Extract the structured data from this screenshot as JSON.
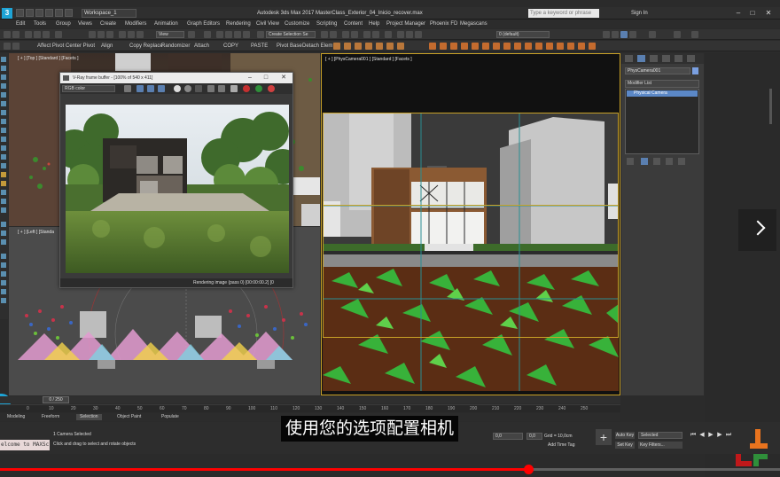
{
  "titlebar": {
    "logo": "3",
    "workspace": "Workspace_1",
    "title": "Autodesk 3ds Max 2017    MasterClass_Exterior_04_Inicio_recover.max",
    "search_placeholder": "Type a keyword or phrase",
    "signin": "Sign In",
    "minimize": "–",
    "maximize": "□",
    "close": "✕"
  },
  "menu": [
    "Edit",
    "Tools",
    "Group",
    "Views",
    "Create",
    "Modifiers",
    "Animation",
    "Graph Editors",
    "Rendering",
    "Civil View",
    "Customize",
    "Scripting",
    "Content",
    "Help",
    "Project Manager",
    "Phoenix FD",
    "Megascans"
  ],
  "toolbar1": {
    "view_dropdown": "View",
    "create_selection": "Create Selection Se",
    "layer_value": "0 (default)"
  },
  "toolbar2": [
    "Affect Pivot",
    "Center Pivot",
    "Align",
    "Copy Replace",
    "Randomizer",
    "Attach",
    "COPY",
    "PASTE",
    "Pivot Base",
    "Detach Elem"
  ],
  "viewports": {
    "top_label": "[ + ] [Top ] [Standard ] [Facets ]",
    "left_label": "[ + ] [Left ] [Standa",
    "main_label": "[ + ] [PhysCamera001 ] [Standard ] [Facets ]"
  },
  "vfb": {
    "title": "V-Ray frame buffer - [100% of 540 x 411]",
    "channel": "RGB color",
    "status": "Rendering image (pass 0) [00:00:00.2] [0"
  },
  "right_panel": {
    "object_name": "PhysCamera001",
    "modifier_list": "Modifier List",
    "stack_item": "Physical Camera"
  },
  "timeline": {
    "slider": "0 / 250",
    "ticks": [
      "0",
      "10",
      "20",
      "30",
      "40",
      "50",
      "60",
      "70",
      "80",
      "90",
      "100",
      "110",
      "120",
      "130",
      "140",
      "150",
      "160",
      "170",
      "180",
      "190",
      "200",
      "210",
      "220",
      "230",
      "240",
      "250"
    ]
  },
  "bottom_tabs": [
    "Modeling",
    "Freeform",
    "Selection",
    "Object Paint",
    "Populate"
  ],
  "status": {
    "maxscript": "elcome to MAXScr",
    "selected": "1 Camera Selected",
    "prompt": "Click and drag to select and rotate objects",
    "x_value": "0,0",
    "y_value": "0,0",
    "grid": "Grid = 10,0cm",
    "add_time_tag": "Add Time Tag",
    "auto_key": "Auto Key",
    "set_key": "Set Key",
    "selected_dd": "Selected",
    "key_filters": "Key Filters..."
  },
  "subtitle": "使用您的选项配置相机",
  "video": {
    "progress": 0.678,
    "next_label": "next"
  },
  "colors": {
    "accent": "#1ea4d6",
    "viewport_border": "#c9a227",
    "progress": "#ff0000",
    "stack_highlight": "#5b88c7"
  }
}
